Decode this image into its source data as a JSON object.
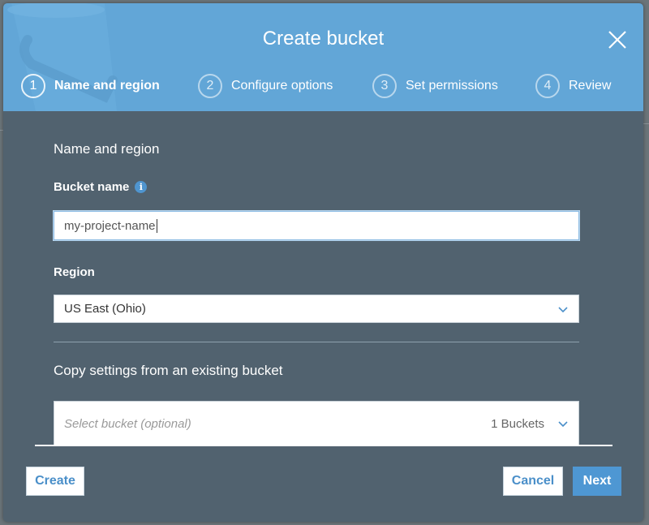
{
  "dialog": {
    "title": "Create bucket",
    "close_icon": "close-icon"
  },
  "steps": [
    {
      "number": "1",
      "label": "Name and region",
      "active": true
    },
    {
      "number": "2",
      "label": "Configure options",
      "active": false
    },
    {
      "number": "3",
      "label": "Set permissions",
      "active": false
    },
    {
      "number": "4",
      "label": "Review",
      "active": false
    }
  ],
  "form": {
    "section_title": "Name and region",
    "bucket_name": {
      "label": "Bucket name",
      "info_icon": "i",
      "value": "my-project-name"
    },
    "region": {
      "label": "Region",
      "selected": "US East (Ohio)"
    },
    "copy_settings": {
      "title": "Copy settings from an existing bucket",
      "placeholder": "Select bucket (optional)",
      "count": "1 Buckets"
    }
  },
  "footer": {
    "create_label": "Create",
    "cancel_label": "Cancel",
    "next_label": "Next"
  },
  "colors": {
    "header_blue": "#62a6d7",
    "body_slate": "#51626f",
    "primary_button": "#4e97d3",
    "link_text": "#4a8fc9"
  }
}
